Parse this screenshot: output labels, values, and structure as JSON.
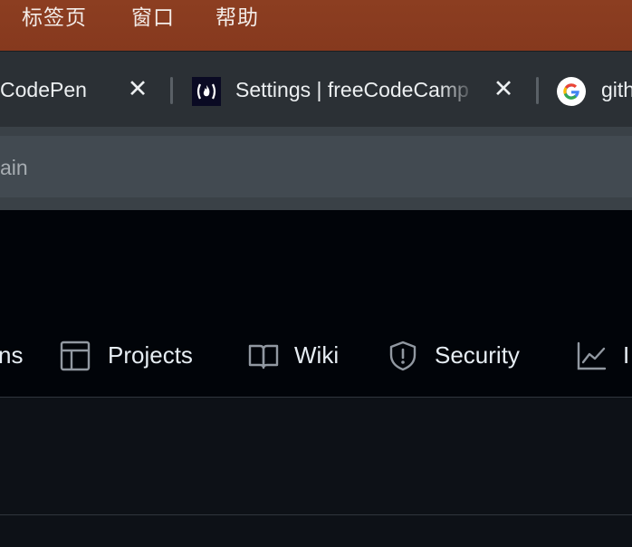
{
  "menubar": {
    "items": [
      "标签页",
      "窗口",
      "帮助"
    ]
  },
  "tabs": [
    {
      "title": "CodePen",
      "close": "✕"
    },
    {
      "title": "Settings | freeCodeCamp",
      "close": "✕",
      "favicon": "freecodecamp-icon"
    },
    {
      "title": "github",
      "favicon": "google-icon"
    }
  ],
  "addressbar": {
    "text": "ain"
  },
  "repo_nav": {
    "items": [
      {
        "label": "ns",
        "icon": "actions-icon"
      },
      {
        "label": "Projects",
        "icon": "table-icon"
      },
      {
        "label": "Wiki",
        "icon": "book-icon"
      },
      {
        "label": "Security",
        "icon": "shield-icon"
      },
      {
        "label": "I",
        "icon": "graph-icon"
      }
    ]
  },
  "colors": {
    "menubar": "#8a3c20",
    "tabstrip": "#2b3035",
    "toolbar": "#3a4147",
    "gh_header": "#010409",
    "gh_body": "#0d1117",
    "text": "#e6edf3"
  }
}
